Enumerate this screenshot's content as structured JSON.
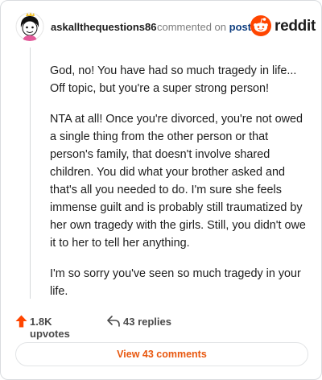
{
  "comment": {
    "username": "askallthequestions86",
    "commented_on": "commented on",
    "post_link": "post",
    "paragraphs": [
      "God, no! You have had so much tragedy in life... Off topic, but you're a super strong person!",
      "NTA at all! Once you're divorced, you're not owed a single thing from the other person or that person's family, that doesn't involve shared children. You did what your brother asked and that's all you needed to do. I'm sure she feels immense guilt and is probably still traumatized by her own tragedy with the girls. Still, you didn't owe it to her to tell her anything.",
      "I'm so sorry you've seen so much tragedy in your life."
    ]
  },
  "brand": {
    "name": "reddit",
    "icon": "reddit-logo-icon",
    "color": "#ff4500"
  },
  "actions": {
    "upvotes": "1.8K upvotes",
    "upvote_icon": "upvote-arrow-icon",
    "upvote_color": "#ff4500",
    "replies": "43 replies",
    "reply_icon": "reply-arrow-icon"
  },
  "view_comments": {
    "label": "View 43 comments",
    "color": "#e8570e"
  }
}
